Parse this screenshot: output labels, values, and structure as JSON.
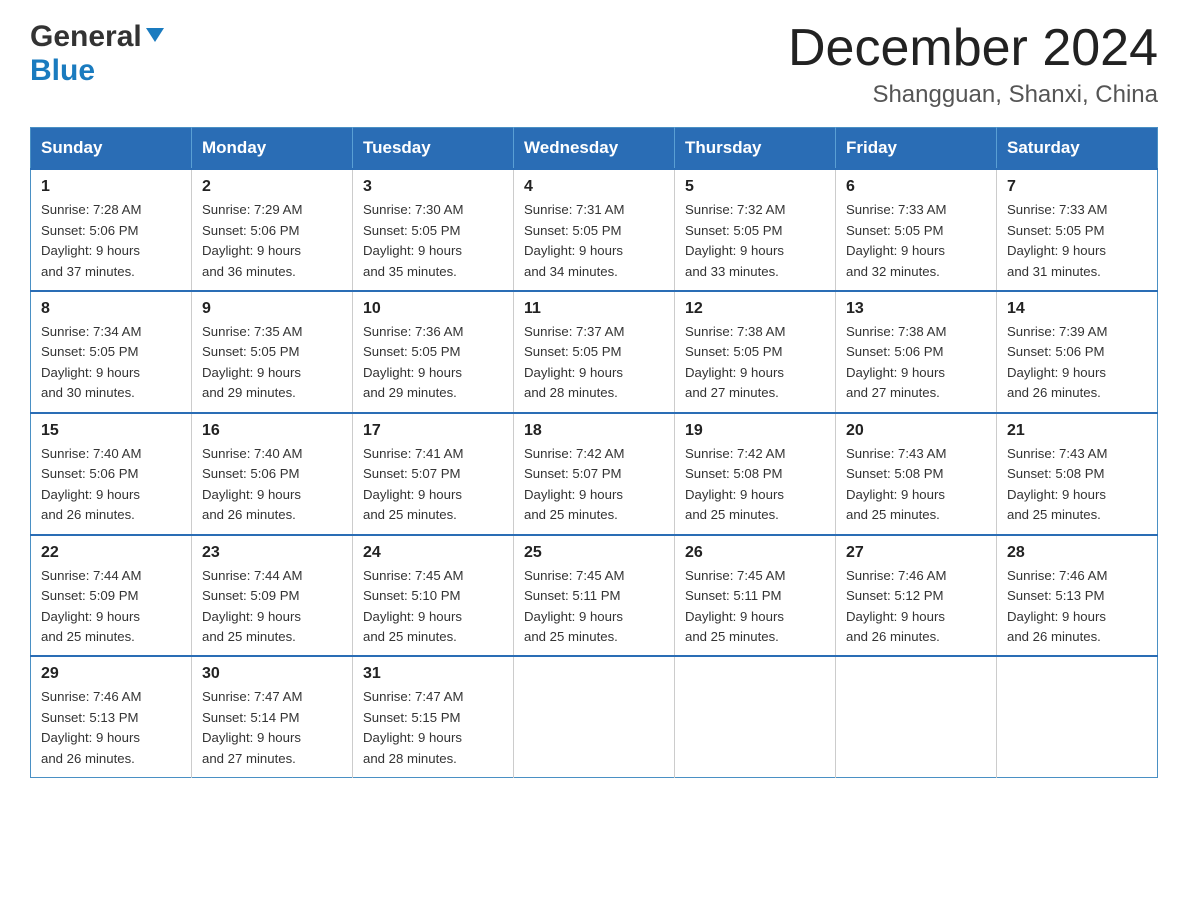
{
  "logo": {
    "general": "General",
    "blue": "Blue"
  },
  "title": {
    "month_year": "December 2024",
    "location": "Shangguan, Shanxi, China"
  },
  "columns": [
    "Sunday",
    "Monday",
    "Tuesday",
    "Wednesday",
    "Thursday",
    "Friday",
    "Saturday"
  ],
  "weeks": [
    [
      {
        "day": "1",
        "sunrise": "7:28 AM",
        "sunset": "5:06 PM",
        "daylight": "9 hours and 37 minutes."
      },
      {
        "day": "2",
        "sunrise": "7:29 AM",
        "sunset": "5:06 PM",
        "daylight": "9 hours and 36 minutes."
      },
      {
        "day": "3",
        "sunrise": "7:30 AM",
        "sunset": "5:05 PM",
        "daylight": "9 hours and 35 minutes."
      },
      {
        "day": "4",
        "sunrise": "7:31 AM",
        "sunset": "5:05 PM",
        "daylight": "9 hours and 34 minutes."
      },
      {
        "day": "5",
        "sunrise": "7:32 AM",
        "sunset": "5:05 PM",
        "daylight": "9 hours and 33 minutes."
      },
      {
        "day": "6",
        "sunrise": "7:33 AM",
        "sunset": "5:05 PM",
        "daylight": "9 hours and 32 minutes."
      },
      {
        "day": "7",
        "sunrise": "7:33 AM",
        "sunset": "5:05 PM",
        "daylight": "9 hours and 31 minutes."
      }
    ],
    [
      {
        "day": "8",
        "sunrise": "7:34 AM",
        "sunset": "5:05 PM",
        "daylight": "9 hours and 30 minutes."
      },
      {
        "day": "9",
        "sunrise": "7:35 AM",
        "sunset": "5:05 PM",
        "daylight": "9 hours and 29 minutes."
      },
      {
        "day": "10",
        "sunrise": "7:36 AM",
        "sunset": "5:05 PM",
        "daylight": "9 hours and 29 minutes."
      },
      {
        "day": "11",
        "sunrise": "7:37 AM",
        "sunset": "5:05 PM",
        "daylight": "9 hours and 28 minutes."
      },
      {
        "day": "12",
        "sunrise": "7:38 AM",
        "sunset": "5:05 PM",
        "daylight": "9 hours and 27 minutes."
      },
      {
        "day": "13",
        "sunrise": "7:38 AM",
        "sunset": "5:06 PM",
        "daylight": "9 hours and 27 minutes."
      },
      {
        "day": "14",
        "sunrise": "7:39 AM",
        "sunset": "5:06 PM",
        "daylight": "9 hours and 26 minutes."
      }
    ],
    [
      {
        "day": "15",
        "sunrise": "7:40 AM",
        "sunset": "5:06 PM",
        "daylight": "9 hours and 26 minutes."
      },
      {
        "day": "16",
        "sunrise": "7:40 AM",
        "sunset": "5:06 PM",
        "daylight": "9 hours and 26 minutes."
      },
      {
        "day": "17",
        "sunrise": "7:41 AM",
        "sunset": "5:07 PM",
        "daylight": "9 hours and 25 minutes."
      },
      {
        "day": "18",
        "sunrise": "7:42 AM",
        "sunset": "5:07 PM",
        "daylight": "9 hours and 25 minutes."
      },
      {
        "day": "19",
        "sunrise": "7:42 AM",
        "sunset": "5:08 PM",
        "daylight": "9 hours and 25 minutes."
      },
      {
        "day": "20",
        "sunrise": "7:43 AM",
        "sunset": "5:08 PM",
        "daylight": "9 hours and 25 minutes."
      },
      {
        "day": "21",
        "sunrise": "7:43 AM",
        "sunset": "5:08 PM",
        "daylight": "9 hours and 25 minutes."
      }
    ],
    [
      {
        "day": "22",
        "sunrise": "7:44 AM",
        "sunset": "5:09 PM",
        "daylight": "9 hours and 25 minutes."
      },
      {
        "day": "23",
        "sunrise": "7:44 AM",
        "sunset": "5:09 PM",
        "daylight": "9 hours and 25 minutes."
      },
      {
        "day": "24",
        "sunrise": "7:45 AM",
        "sunset": "5:10 PM",
        "daylight": "9 hours and 25 minutes."
      },
      {
        "day": "25",
        "sunrise": "7:45 AM",
        "sunset": "5:11 PM",
        "daylight": "9 hours and 25 minutes."
      },
      {
        "day": "26",
        "sunrise": "7:45 AM",
        "sunset": "5:11 PM",
        "daylight": "9 hours and 25 minutes."
      },
      {
        "day": "27",
        "sunrise": "7:46 AM",
        "sunset": "5:12 PM",
        "daylight": "9 hours and 26 minutes."
      },
      {
        "day": "28",
        "sunrise": "7:46 AM",
        "sunset": "5:13 PM",
        "daylight": "9 hours and 26 minutes."
      }
    ],
    [
      {
        "day": "29",
        "sunrise": "7:46 AM",
        "sunset": "5:13 PM",
        "daylight": "9 hours and 26 minutes."
      },
      {
        "day": "30",
        "sunrise": "7:47 AM",
        "sunset": "5:14 PM",
        "daylight": "9 hours and 27 minutes."
      },
      {
        "day": "31",
        "sunrise": "7:47 AM",
        "sunset": "5:15 PM",
        "daylight": "9 hours and 28 minutes."
      },
      null,
      null,
      null,
      null
    ]
  ]
}
